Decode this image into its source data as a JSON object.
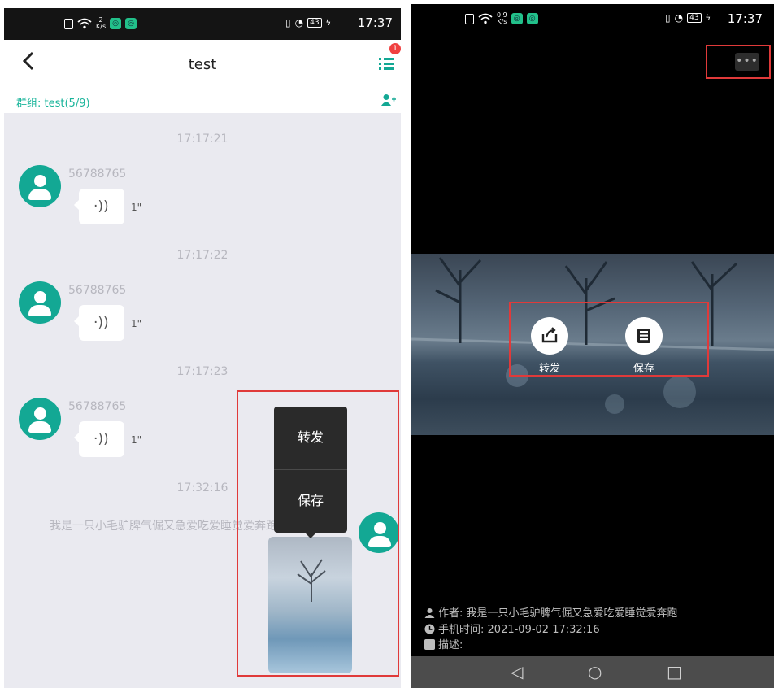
{
  "left": {
    "status": {
      "time": "17:37",
      "speed_value": "2",
      "speed_unit": "K/s",
      "battery": "43"
    },
    "nav": {
      "back_icon": "‹",
      "title": "test",
      "badge": "1"
    },
    "group": {
      "label": "群组: test(5/9)"
    },
    "messages": [
      {
        "timestamp": "17:17:21",
        "sender": "56788765",
        "duration": "1\""
      },
      {
        "timestamp": "17:17:22",
        "sender": "56788765",
        "duration": "1\""
      },
      {
        "timestamp": "17:17:23",
        "sender": "56788765",
        "duration": "1\""
      }
    ],
    "last_timestamp": "17:32:16",
    "author_line": "我是一只小毛驴脾气倔又急爱吃爱睡觉爱奔跑",
    "popup": {
      "forward": "转发",
      "save": "保存"
    },
    "icons": {
      "voice": "voice-icon",
      "avatar": "user-avatar-icon",
      "menu": "list-menu-icon",
      "add_member": "add-member-icon"
    }
  },
  "right": {
    "status": {
      "time": "17:37",
      "speed_value": "0.9",
      "speed_unit": "K/s",
      "battery": "43"
    },
    "more": "•••",
    "actions": {
      "forward": "转发",
      "save": "保存"
    },
    "meta": {
      "author_label": "作者:",
      "author_value": "我是一只小毛驴脾气倔又急爱吃爱睡觉爱奔跑",
      "time_label": "手机时间:",
      "time_value": "2021-09-02 17:32:16",
      "desc_label": "描述:"
    },
    "nav": {
      "back": "◁",
      "home": "○",
      "recent": "□"
    }
  },
  "colors": {
    "accent": "#13a894",
    "highlight": "#e03a3a",
    "badge": "#f04040"
  }
}
